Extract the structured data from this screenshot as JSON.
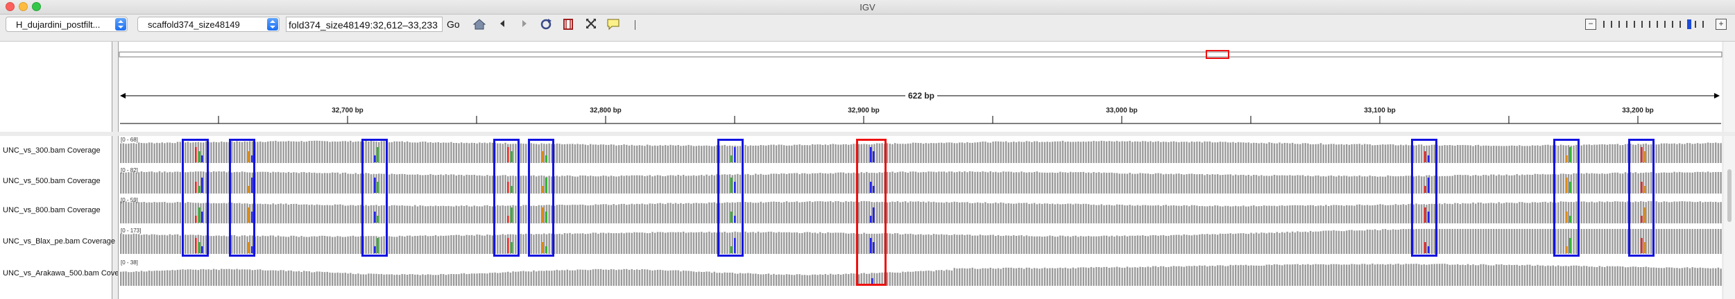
{
  "window": {
    "title": "IGV"
  },
  "toolbar": {
    "genome_select": "H_dujardini_postfilt...",
    "chromosome_select": "scaffold374_size48149",
    "locus_value": "fold374_size48149:32,612–33,233",
    "go_label": "Go",
    "icons": [
      "home-icon",
      "back-icon",
      "forward-icon",
      "refresh-icon",
      "roi-icon",
      "resize-icon",
      "popup-text-icon"
    ]
  },
  "ruler": {
    "span_label": "622 bp",
    "ticks": [
      "32,700 bp",
      "32,800 bp",
      "32,900 bp",
      "33,000 bp",
      "33,100 bp",
      "33,200 bp"
    ]
  },
  "tracks": [
    {
      "name": "UNC_vs_300.bam Coverage",
      "range": "[0 - 68]"
    },
    {
      "name": "UNC_vs_500.bam Coverage",
      "range": "[0 - 82]"
    },
    {
      "name": "UNC_vs_800.bam Coverage",
      "range": "[0 - 59]"
    },
    {
      "name": "UNC_vs_Blax_pe.bam Coverage",
      "range": "[0 - 173]"
    },
    {
      "name": "UNC_vs_Arakawa_500.bam Cove",
      "range": "[0 - 38]"
    }
  ],
  "colors": {
    "coverage_bar": "#9a9a9a",
    "highlight_blue": "#1313e0",
    "highlight_red": "#ee1111",
    "base_A": "#22bb22",
    "base_C": "#2222ee",
    "base_G": "#d98a1a",
    "base_T": "#ee2222"
  }
}
